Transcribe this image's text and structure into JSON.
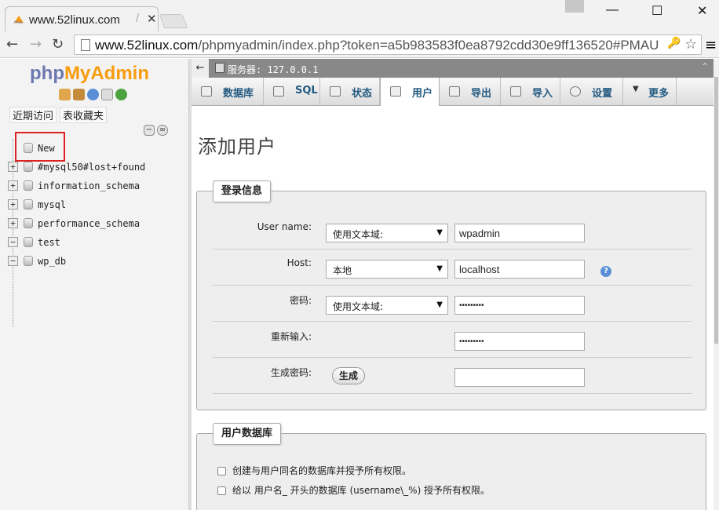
{
  "browser": {
    "tab_title": "www.52linux.com",
    "tab_separator": "/",
    "url_host": "www.52linux.com",
    "url_path": "/phpmyadmin/index.php?token=a5b983583f0ea8792cdd30e9ff136520#PMAU"
  },
  "sidebar": {
    "logo_php": "php",
    "logo_myadmin": "MyAdmin",
    "recent_label": "近期访问",
    "favorites_label": "表收藏夹",
    "tree": [
      {
        "label": "New",
        "expander": ""
      },
      {
        "label": "#mysql50#lost+found",
        "expander": "+"
      },
      {
        "label": "information_schema",
        "expander": "+"
      },
      {
        "label": "mysql",
        "expander": "+"
      },
      {
        "label": "performance_schema",
        "expander": "+"
      },
      {
        "label": "test",
        "expander": "−"
      },
      {
        "label": "wp_db",
        "expander": "−"
      }
    ]
  },
  "server_bar": {
    "text": "服务器: 127.0.0.1"
  },
  "tabs": [
    {
      "label": "数据库"
    },
    {
      "label": "SQL"
    },
    {
      "label": "状态"
    },
    {
      "label": "用户"
    },
    {
      "label": "导出"
    },
    {
      "label": "导入"
    },
    {
      "label": "设置"
    },
    {
      "label": "更多"
    }
  ],
  "page": {
    "title": "添加用户",
    "login_legend": "登录信息",
    "fields": {
      "username_label": "User name:",
      "username_select": "使用文本域:",
      "username_value": "wpadmin",
      "host_label": "Host:",
      "host_select": "本地",
      "host_value": "localhost",
      "password_label": "密码:",
      "password_select": "使用文本域:",
      "password_value": "•••••••••",
      "retype_label": "重新输入:",
      "retype_value": "•••••••••",
      "generate_label": "生成密码:",
      "generate_button": "生成",
      "generated_value": ""
    },
    "db_legend": "用户数据库",
    "db_options": [
      "创建与用户同名的数据库并授予所有权限。",
      "给以 用户名_ 开头的数据库 (username\\_%) 授予所有权限。"
    ]
  }
}
